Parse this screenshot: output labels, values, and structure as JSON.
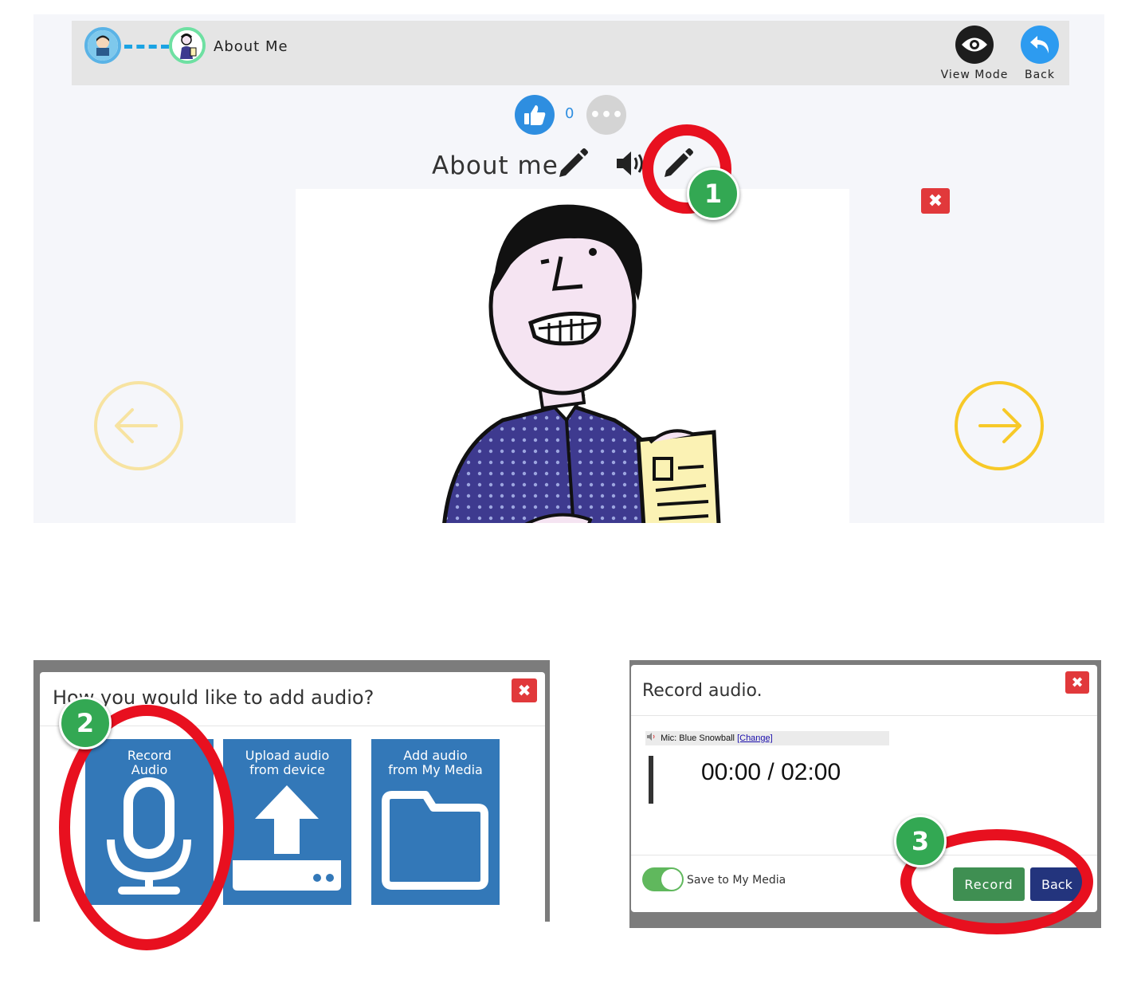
{
  "header": {
    "breadcrumb_title": "About Me",
    "view_mode_label": "View Mode",
    "back_label": "Back"
  },
  "likes": {
    "count": "0",
    "more": "•••"
  },
  "page": {
    "title": "About me"
  },
  "icons": {
    "student_avatar": "student-avatar-icon",
    "page_avatar": "page-avatar-icon",
    "view_mode": "eye-icon",
    "back": "undo-arrow-icon",
    "like": "thumbs-up-icon",
    "more": "ellipsis-icon",
    "title_edit": "pencil-icon",
    "audio": "speaker-icon",
    "audio_edit": "pencil-icon",
    "close": "close-icon",
    "prev": "arrow-left-circle-icon",
    "next": "arrow-right-circle-icon",
    "record": "microphone-icon",
    "upload": "upload-icon",
    "folder": "folder-icon"
  },
  "close_glyph": "✖",
  "steps": [
    "1",
    "2",
    "3"
  ],
  "dialog_add_audio": {
    "title": "How you would like to add audio?",
    "options": [
      {
        "label": "Record\nAudio"
      },
      {
        "label": "Upload audio\nfrom device"
      },
      {
        "label": "Add audio\nfrom My Media"
      }
    ]
  },
  "dialog_record": {
    "title": "Record audio.",
    "mic_label": "Mic: Blue Snowball",
    "mic_change": "[Change]",
    "timer": "00:00 / 02:00",
    "save_label": "Save to My Media",
    "save_on": true,
    "record_label": "Record",
    "back_label": "Back"
  },
  "colors": {
    "accent_blue": "#2e8ee0",
    "option_blue": "#3378b8",
    "close_red": "#e1393b",
    "annotation_red": "#e8101f",
    "step_green": "#33a853",
    "arrow_yellow": "#f7c928",
    "record_green": "#3f8f52",
    "back_navy": "#23347d"
  }
}
